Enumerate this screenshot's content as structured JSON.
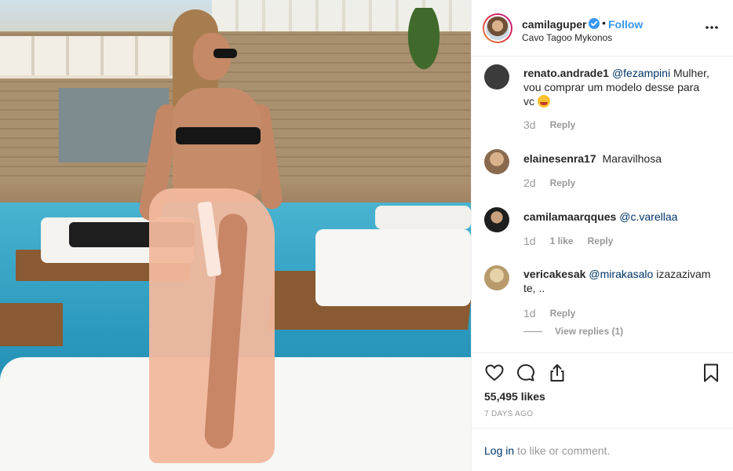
{
  "post": {
    "username": "camilaguper",
    "follow_label": "Follow",
    "dot": "•",
    "location": "Cavo Tagoo Mykonos"
  },
  "comments": [
    {
      "user": "renato.andrade1",
      "mention": "@fezampini",
      "text": "Mulher, vou comprar um modelo desse para vc",
      "emoji": "smiling-face-with-heart-eyes",
      "time": "3d",
      "likes": "",
      "reply": "Reply",
      "avatar_color": "#3b3b3b"
    },
    {
      "user": "elainesenra17",
      "mention": "",
      "text": "Maravilhosa",
      "emoji": "",
      "time": "2d",
      "likes": "",
      "reply": "Reply",
      "avatar_color": "#b7876a"
    },
    {
      "user": "camilamaarqques",
      "mention": "@c.varellaa",
      "text": "",
      "emoji": "",
      "time": "1d",
      "likes": "1 like",
      "reply": "Reply",
      "avatar_color": "#2a2a2a"
    },
    {
      "user": "vericakesak",
      "mention": "@mirakasalo",
      "text": "izazazivam te, ..",
      "emoji": "",
      "time": "1d",
      "likes": "",
      "reply": "Reply",
      "avatar_color": "#d8c39a"
    }
  ],
  "view_replies_label": "View replies (1)",
  "likes_label": "55,495 likes",
  "date_label": "7 DAYS AGO",
  "login": {
    "link": "Log in",
    "rest": " to like or comment."
  },
  "icons": [
    "verified-badge-icon",
    "more-options-icon",
    "heart-icon",
    "comment-icon",
    "share-icon",
    "bookmark-icon"
  ],
  "colors": {
    "link": "#003569",
    "follow": "#3897f0",
    "meta": "#999999",
    "text": "#262626"
  }
}
